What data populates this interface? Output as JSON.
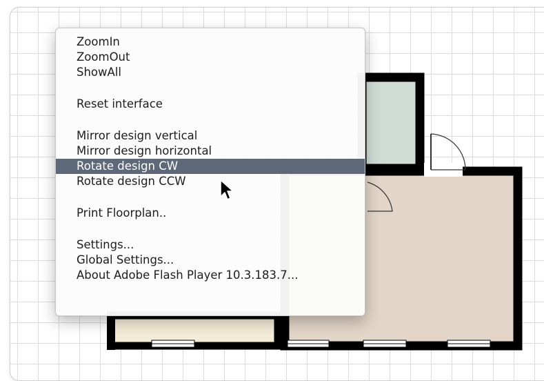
{
  "context_menu": {
    "groups": [
      {
        "items": [
          "ZoomIn",
          "ZoomOut",
          "ShowAll"
        ]
      },
      {
        "items": [
          "Reset interface"
        ]
      },
      {
        "items": [
          "Mirror design vertical",
          "Mirror design horizontal",
          "Rotate design CW",
          "Rotate design CCW"
        ]
      },
      {
        "items": [
          "Print Floorplan.."
        ]
      },
      {
        "items": [
          "Settings...",
          "Global Settings...",
          "About Adobe Flash Player 10.3.183.7..."
        ]
      }
    ],
    "highlighted_item": "Rotate design CW"
  },
  "colors": {
    "menu_highlight": "#5d6879",
    "wall": "#000000",
    "room_beige": "#e3d6c8",
    "room_teal": "#cfdcd6",
    "room_cream": "#f3ecd6",
    "grid_line": "#dcdcdc"
  }
}
